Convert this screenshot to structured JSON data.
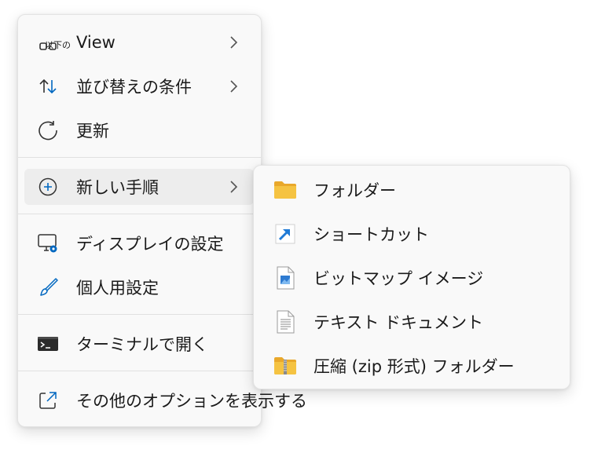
{
  "main_menu": {
    "items": [
      {
        "label": "View",
        "icon": "view-grid-icon",
        "overlay": "以下の",
        "submenu": true
      },
      {
        "label": "並び替えの条件",
        "icon": "sort-arrows-icon",
        "submenu": true
      },
      {
        "label": "更新",
        "icon": "refresh-icon",
        "submenu": false
      },
      {
        "label": "新しい手順",
        "icon": "add-circle-icon",
        "submenu": true,
        "hovered": true
      },
      {
        "label": "ディスプレイの設定",
        "icon": "display-settings-icon",
        "submenu": false
      },
      {
        "label": "個人用設定",
        "icon": "brush-icon",
        "submenu": false
      },
      {
        "label": "ターミナルで開く",
        "icon": "terminal-icon",
        "submenu": false
      },
      {
        "label": "その他のオプションを表示する",
        "icon": "share-icon",
        "submenu": false
      }
    ]
  },
  "sub_menu": {
    "items": [
      {
        "label": "フォルダー",
        "icon": "folder-icon"
      },
      {
        "label": "ショートカット",
        "icon": "shortcut-icon"
      },
      {
        "label": "ビットマップ イメージ",
        "icon": "bitmap-image-icon"
      },
      {
        "label": "テキスト ドキュメント",
        "icon": "text-document-icon"
      },
      {
        "label": "圧縮 (zip 形式) フォルダー",
        "icon": "zip-folder-icon"
      }
    ]
  },
  "colors": {
    "accent": "#0067c0",
    "folder": "#f5c342",
    "menu_bg": "#f9f9f9",
    "hover_bg": "#ededed"
  }
}
